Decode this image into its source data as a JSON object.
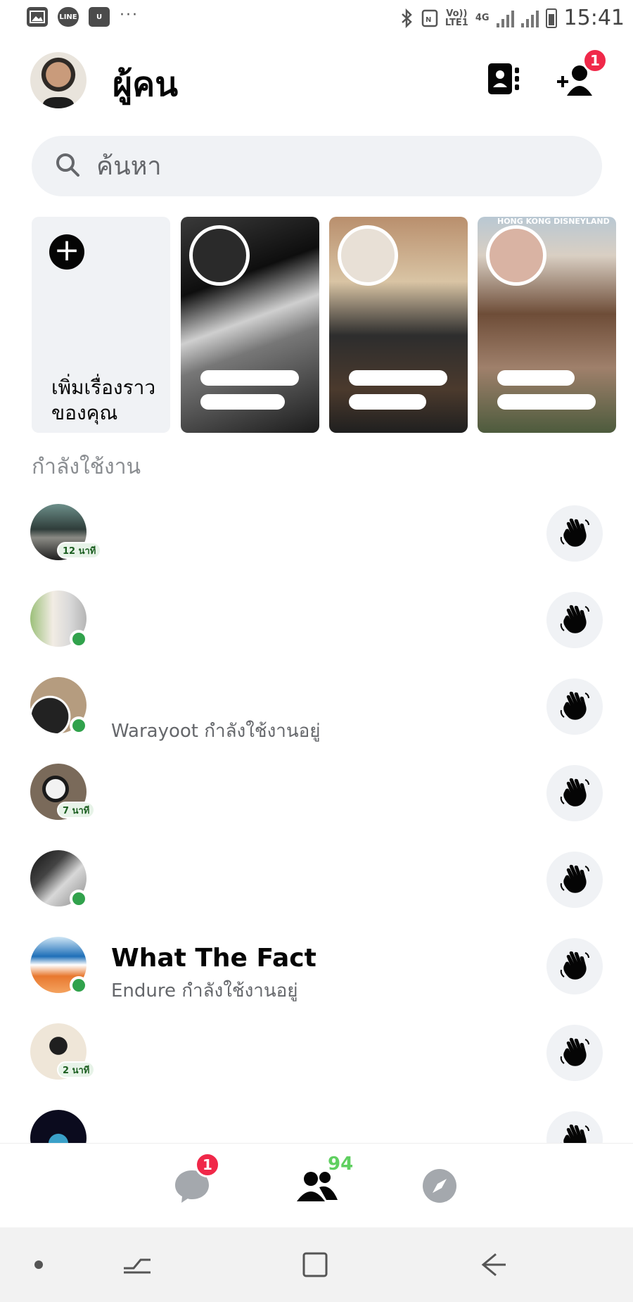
{
  "status_bar": {
    "left_icons": [
      "gallery-icon",
      "line-icon",
      "u-icon"
    ],
    "line_label": "LINE",
    "u_label": "U",
    "more": "···",
    "network_top": "Vo))",
    "network_bottom": "LTE1",
    "network_type": "4G",
    "time": "15:41"
  },
  "header": {
    "title": "ผู้คน",
    "add_friend_badge": "1"
  },
  "search": {
    "placeholder": "ค้นหา"
  },
  "stories": {
    "add_label": "เพิ่มเรื่องราวของคุณ",
    "story3_tag": "HONG KONG DISNEYLAND"
  },
  "active_section": {
    "title": "กำลังใช้งาน",
    "rows": [
      {
        "name": "",
        "status": "",
        "time": "12 นาที",
        "online": false
      },
      {
        "name": "",
        "status": "",
        "time": "",
        "online": true
      },
      {
        "name": "",
        "status": "Warayoot กำลังใช้งานอยู่",
        "time": "",
        "online": true
      },
      {
        "name": "",
        "status": "",
        "time": "7 นาที",
        "online": false
      },
      {
        "name": "",
        "status": "",
        "time": "",
        "online": true
      },
      {
        "name": "What The Fact",
        "status": "Endure กำลังใช้งานอยู่",
        "time": "",
        "online": true
      },
      {
        "name": "",
        "status": "",
        "time": "2 นาที",
        "online": false
      },
      {
        "name": "",
        "status": "",
        "time": "",
        "online": false
      }
    ]
  },
  "tabbar": {
    "chats_badge": "1",
    "people_count": "94"
  },
  "colors": {
    "online": "#31a24c",
    "badge": "#f02849",
    "people_count": "#5fcf60",
    "search_bg": "#f0f2f5"
  }
}
